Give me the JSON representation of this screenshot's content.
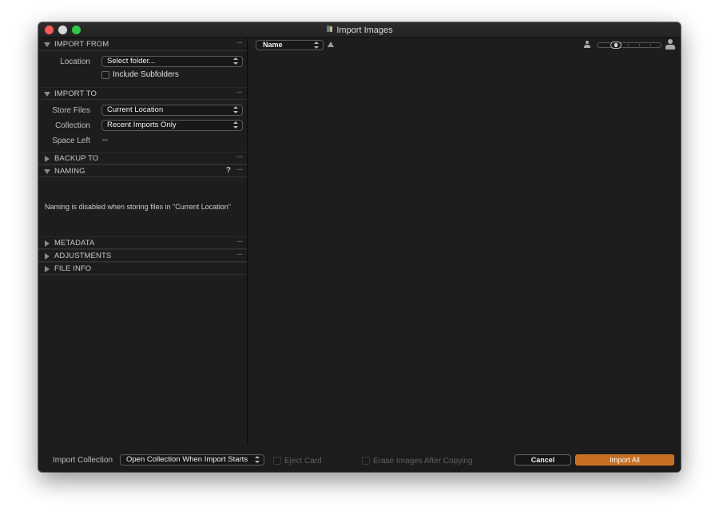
{
  "window": {
    "title": "Import Images",
    "app_icon": "import-images-icon"
  },
  "sidebar": {
    "import_from": {
      "title": "IMPORT FROM",
      "expanded": true,
      "location_label": "Location",
      "location_value": "Select folder...",
      "include_subfolders_label": "Include Subfolders",
      "include_subfolders_checked": false
    },
    "import_to": {
      "title": "IMPORT TO",
      "expanded": true,
      "store_files_label": "Store Files",
      "store_files_value": "Current Location",
      "collection_label": "Collection",
      "collection_value": "Recent Imports Only",
      "space_left_label": "Space Left",
      "space_left_value": "--"
    },
    "backup_to": {
      "title": "BACKUP TO",
      "expanded": false
    },
    "naming": {
      "title": "NAMING",
      "expanded": true,
      "help": "?",
      "message": "Naming is disabled when storing files in \"Current Location\""
    },
    "metadata": {
      "title": "METADATA",
      "expanded": false
    },
    "adjustments": {
      "title": "ADJUSTMENTS",
      "expanded": false
    },
    "file_info": {
      "title": "FILE INFO",
      "expanded": false
    },
    "more_glyph": "···"
  },
  "main": {
    "sort_by": "Name",
    "sort_direction": "ascending",
    "thumbnail_size_level": 0.25
  },
  "footer": {
    "import_collection_label": "Import Collection",
    "import_collection_value": "Open Collection When Import Starts",
    "eject_card_label": "Eject Card",
    "eject_card_checked": false,
    "eject_card_enabled": false,
    "erase_images_label": "Erase Images After Copying",
    "erase_images_checked": false,
    "erase_images_enabled": false,
    "cancel_label": "Cancel",
    "import_all_label": "Import All"
  },
  "colors": {
    "accent": "#c96d22",
    "background": "#1c1c1c",
    "close": "#fc5b57",
    "minimize": "#d8d8d8",
    "maximize": "#33c748"
  }
}
